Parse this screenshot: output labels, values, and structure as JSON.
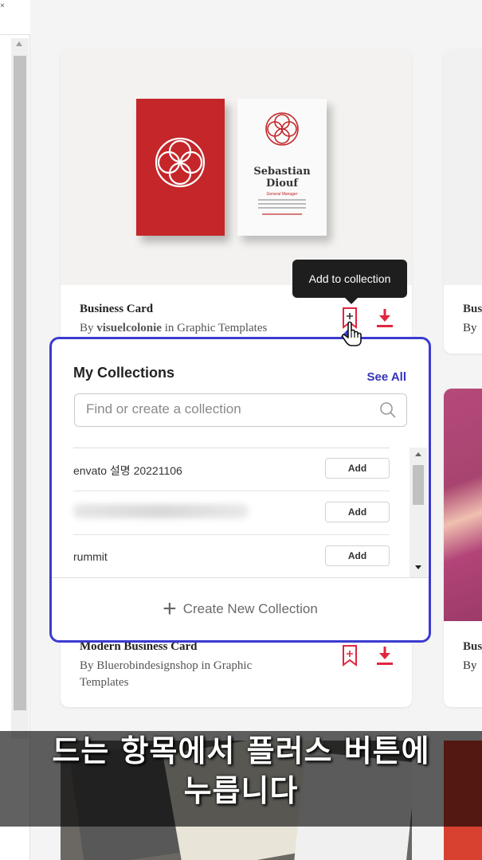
{
  "tooltip": "Add to collection",
  "cards": {
    "first": {
      "mockup_name": "Sebastian\nDiouf",
      "mockup_role": "General Manager",
      "title": "Business Card",
      "author_prefix": "By ",
      "author": "visuelcolonie",
      "author_suffix": " in Graphic Templates"
    },
    "second": {
      "title": "Modern Business Card",
      "author_line1": "By Bluerobindesignshop in Graphic",
      "author_line2": "Templates"
    },
    "right_a": {
      "title": "Bus",
      "author": "By "
    },
    "right_b": {
      "title": "Bus",
      "author": "By "
    }
  },
  "collections_popup": {
    "title": "My Collections",
    "see_all": "See All",
    "search_placeholder": "Find or create a collection",
    "items": [
      {
        "name": "envato 설명 20221106",
        "add_label": "Add"
      },
      {
        "name": "",
        "add_label": "Add"
      },
      {
        "name": "rummit",
        "add_label": "Add"
      }
    ],
    "create_new": "Create New Collection"
  },
  "subtitle": {
    "line1": "드는 항목에서 플러스 버튼에",
    "line2": "누릅니다"
  },
  "colors": {
    "accent": "#3b3bd1",
    "brand_red": "#e0263f",
    "card_red": "#c4262a"
  }
}
